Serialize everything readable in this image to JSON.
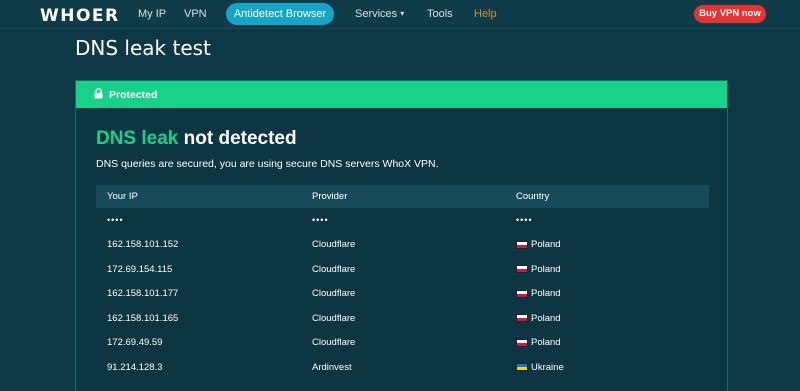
{
  "nav": {
    "logo": "WHOER",
    "links": [
      "My IP",
      "VPN",
      "Antidetect Browser",
      "Services",
      "Tools",
      "Help"
    ],
    "buy_label": "Buy VPN now"
  },
  "page": {
    "title": "DNS leak test"
  },
  "card": {
    "status": "Protected",
    "result_accent": "DNS leak",
    "result_rest": " not detected",
    "subtitle": "DNS queries are secured, you are using secure DNS servers WhoX VPN.",
    "columns": [
      "Your IP",
      "Provider",
      "Country"
    ],
    "placeholder": "••••",
    "rows": [
      {
        "ip": "162.158.101.152",
        "provider": "Cloudflare",
        "country": "Poland",
        "flag": "pl"
      },
      {
        "ip": "172.69.154.115",
        "provider": "Cloudflare",
        "country": "Poland",
        "flag": "pl"
      },
      {
        "ip": "162.158.101.177",
        "provider": "Cloudflare",
        "country": "Poland",
        "flag": "pl"
      },
      {
        "ip": "162.158.101.165",
        "provider": "Cloudflare",
        "country": "Poland",
        "flag": "pl"
      },
      {
        "ip": "172.69.49.59",
        "provider": "Cloudflare",
        "country": "Poland",
        "flag": "pl"
      },
      {
        "ip": "91.214.128.3",
        "provider": "Ardinvest",
        "country": "Ukraine",
        "flag": "ua"
      }
    ]
  },
  "colors": {
    "accent": "#19d28a",
    "pill": "#14a5c9",
    "buy": "#e63232",
    "help": "#e08a3e",
    "bg": "#0e3845"
  },
  "icons": {
    "status": "lock-icon",
    "services_dropdown": "chevron-down-icon"
  }
}
